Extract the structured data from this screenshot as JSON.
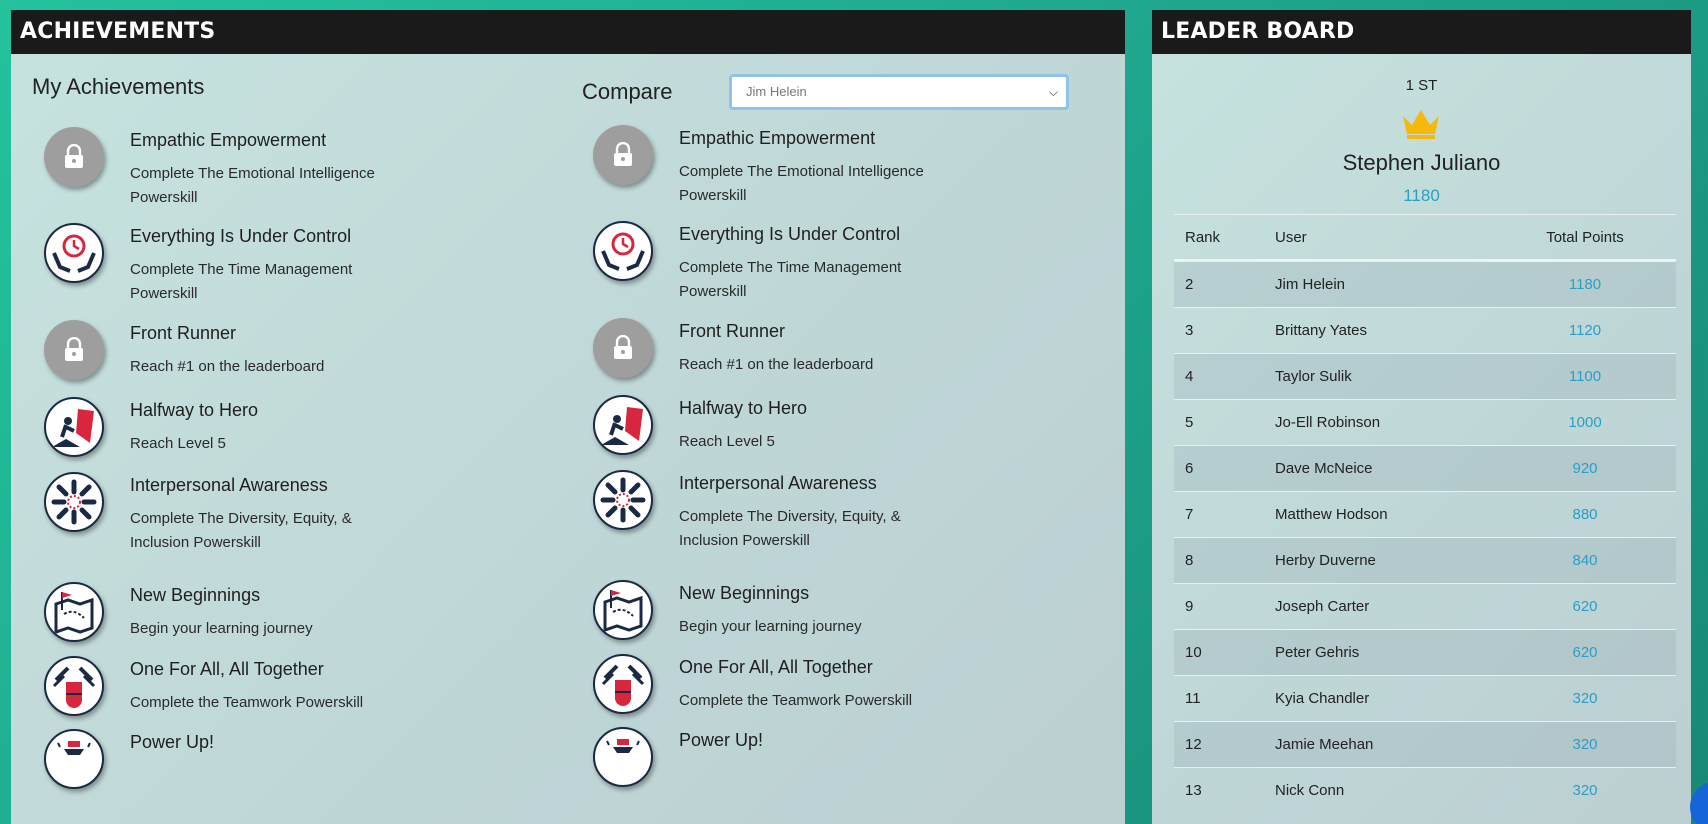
{
  "achievements_panel": {
    "title": "ACHIEVEMENTS",
    "my_title": "My Achievements",
    "compare_label": "Compare",
    "compare_selected": "Jim Helein",
    "items": [
      {
        "name": "Empathic Empowerment",
        "desc": "Complete The Emotional Intelligence Powerskill",
        "icon": "lock-icon",
        "locked": true
      },
      {
        "name": "Everything Is Under Control",
        "desc": "Complete The Time Management Powerskill",
        "icon": "clock-hands-icon",
        "locked": false
      },
      {
        "name": "Front Runner",
        "desc": "Reach #1 on the leaderboard",
        "icon": "lock-icon",
        "locked": true
      },
      {
        "name": "Halfway to Hero",
        "desc": "Reach Level 5",
        "icon": "hero-cape-icon",
        "locked": false
      },
      {
        "name": "Interpersonal Awareness",
        "desc": "Complete The Diversity, Equity, & Inclusion Powerskill",
        "icon": "inclusion-hands-icon",
        "locked": false
      },
      {
        "name": "New Beginnings",
        "desc": "Begin your learning journey",
        "icon": "map-flag-icon",
        "locked": false
      },
      {
        "name": "One For All, All Together",
        "desc": "Complete the Teamwork Powerskill",
        "icon": "teamwork-hands-icon",
        "locked": false
      },
      {
        "name": "Power Up!",
        "desc": "",
        "icon": "power-up-icon",
        "locked": false
      }
    ]
  },
  "leaderboard": {
    "title": "LEADER BOARD",
    "first_label": "1 ST",
    "top_user": "Stephen Juliano",
    "top_points": "1180",
    "columns": {
      "rank": "Rank",
      "user": "User",
      "points": "Total Points"
    },
    "rows": [
      {
        "rank": "2",
        "user": "Jim Helein",
        "points": "1180"
      },
      {
        "rank": "3",
        "user": "Brittany Yates",
        "points": "1120"
      },
      {
        "rank": "4",
        "user": "Taylor Sulik",
        "points": "1100"
      },
      {
        "rank": "5",
        "user": "Jo-Ell Robinson",
        "points": "1000"
      },
      {
        "rank": "6",
        "user": "Dave McNeice",
        "points": "920"
      },
      {
        "rank": "7",
        "user": "Matthew Hodson",
        "points": "880"
      },
      {
        "rank": "8",
        "user": "Herby Duverne",
        "points": "840"
      },
      {
        "rank": "9",
        "user": "Joseph Carter",
        "points": "620"
      },
      {
        "rank": "10",
        "user": "Peter Gehris",
        "points": "620"
      },
      {
        "rank": "11",
        "user": "Kyia Chandler",
        "points": "320"
      },
      {
        "rank": "12",
        "user": "Jamie Meehan",
        "points": "320"
      },
      {
        "rank": "13",
        "user": "Nick Conn",
        "points": "320"
      }
    ]
  },
  "colors": {
    "header_bg": "#1a1a1a",
    "points_accent": "#2a9fc6",
    "crown": "#f5b80b",
    "badge_dark": "#1b2a44",
    "badge_red": "#d7263d"
  }
}
